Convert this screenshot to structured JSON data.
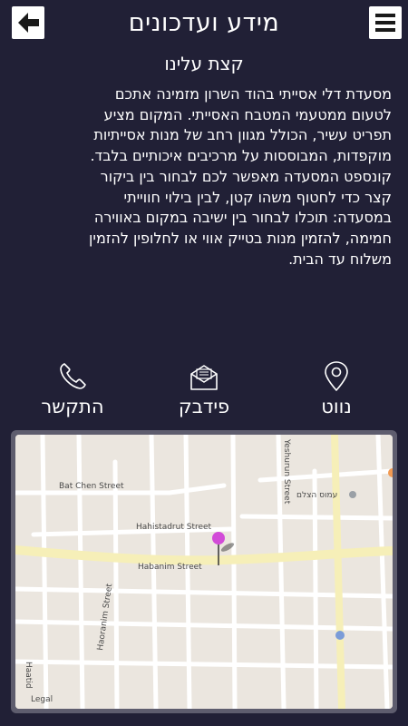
{
  "header": {
    "title": "מידע ועדכונים",
    "back_icon": "arrow-left-icon",
    "menu_icon": "hamburger-menu-icon"
  },
  "about": {
    "title": "קצת עלינו",
    "lines": [
      "מסעדת דלי אסייתי בהוד השרון מזמינה אתכם",
      "לטעום ממטעמי המטבח האסייתי. המקום מציע",
      "תפריט עשיר, הכולל מגוון רחב של מנות אסייתיות",
      "מוקפדות, המבוססות על מרכיבים איכותיים בלבד.",
      "קונספט המסעדה מאפשר לכם לבחור בין ביקור",
      "קצר כדי לחטוף משהו קטן, לבין בילוי חווייתי",
      "במסעדה: תוכלו לבחור בין ישיבה במקום באווירה",
      "חמימה, להזמין מנות בטייק אווי או לחלופין להזמין",
      "משלוח עד הבית."
    ]
  },
  "actions": {
    "call": {
      "label": "התקשר",
      "icon": "phone-icon"
    },
    "feedback": {
      "label": "פידבק",
      "icon": "envelope-icon"
    },
    "navigate": {
      "label": "נווט",
      "icon": "location-pin-icon"
    }
  },
  "map": {
    "streets": {
      "bat_chen": "Bat Chen Street",
      "hahistadrut": "Hahistadrut Street",
      "habanim": "Habanim Street",
      "haoranim": "Haoranim Street",
      "yeshurun": "Yeshurun Street",
      "haatid": "Haatid"
    },
    "poi_label": "עמוס הצלם",
    "legal_label": "Legal",
    "marker_color": "#d24bd8"
  },
  "colors": {
    "background": "#212036",
    "map_land": "#ebe6df",
    "major_road": "#f6efb8"
  }
}
